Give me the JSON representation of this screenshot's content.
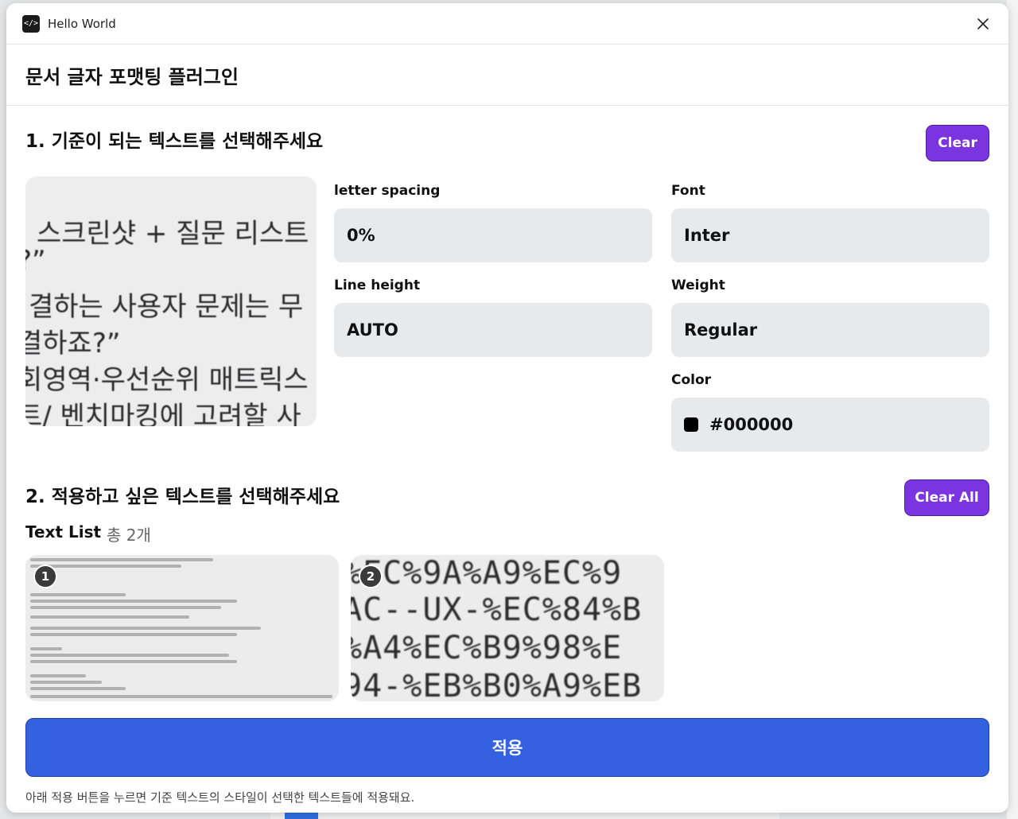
{
  "window": {
    "title": "Hello World",
    "icon": "code-icon"
  },
  "page": {
    "title": "문서 글자 포맷팅 플러그인"
  },
  "section1": {
    "title": "1. 기준이 되는 텍스트를 선택해주세요",
    "clear_label": "Clear"
  },
  "preview": {
    "lines": [
      "스크린샷 + 질문 리스트",
      "?”",
      "결하는 사용자 문제는 무",
      "결하죠?”",
      "회영역·우선순위 매트릭스",
      "트/ 벤치마킹에 고려할 사"
    ]
  },
  "fields": {
    "letter_spacing": {
      "label": "letter spacing",
      "value": "0%"
    },
    "font": {
      "label": "Font",
      "value": "Inter"
    },
    "line_height": {
      "label": "Line height",
      "value": "AUTO"
    },
    "weight": {
      "label": "Weight",
      "value": "Regular"
    },
    "color": {
      "label": "Color",
      "value": "#000000",
      "swatch": "#000000"
    }
  },
  "section2": {
    "title": "2. 적용하고 싶은 텍스트를 선택해주세요",
    "clear_all_label": "Clear All"
  },
  "text_list": {
    "title": "Text List",
    "count": "총 2개",
    "items": [
      {
        "badge": "1"
      },
      {
        "badge": "2",
        "lines": [
          "%EC%9A%A9%EC%9",
          "AC--UX-%EC%84%B",
          "%A4%EC%B9%98%E",
          "94-%EB%B0%A9%EB"
        ]
      }
    ]
  },
  "apply": {
    "label": "적용"
  },
  "footnote": "아래 적용 버튼을 누르면 기준 텍스트의 스타일이 선택한 텍스트들에 적용돼요.",
  "colors": {
    "accent_purple": "#7a35e0",
    "apply_blue": "#3461e0",
    "field_bg": "#e8e9eb"
  }
}
